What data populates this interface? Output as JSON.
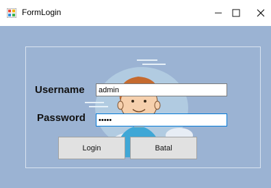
{
  "window": {
    "title": "FormLogin",
    "icon": "form-app-icon",
    "controls": {
      "minimize_icon": "minimize-icon",
      "maximize_icon": "maximize-icon",
      "close_icon": "close-icon"
    },
    "client_background": "#9bb3d3"
  },
  "form": {
    "username_label": "Username",
    "username_value": "admin",
    "password_label": "Password",
    "password_value": "•••••",
    "login_button": "Login",
    "cancel_button": "Batal"
  },
  "illustration": {
    "icon": "user-avatar-illustration"
  }
}
